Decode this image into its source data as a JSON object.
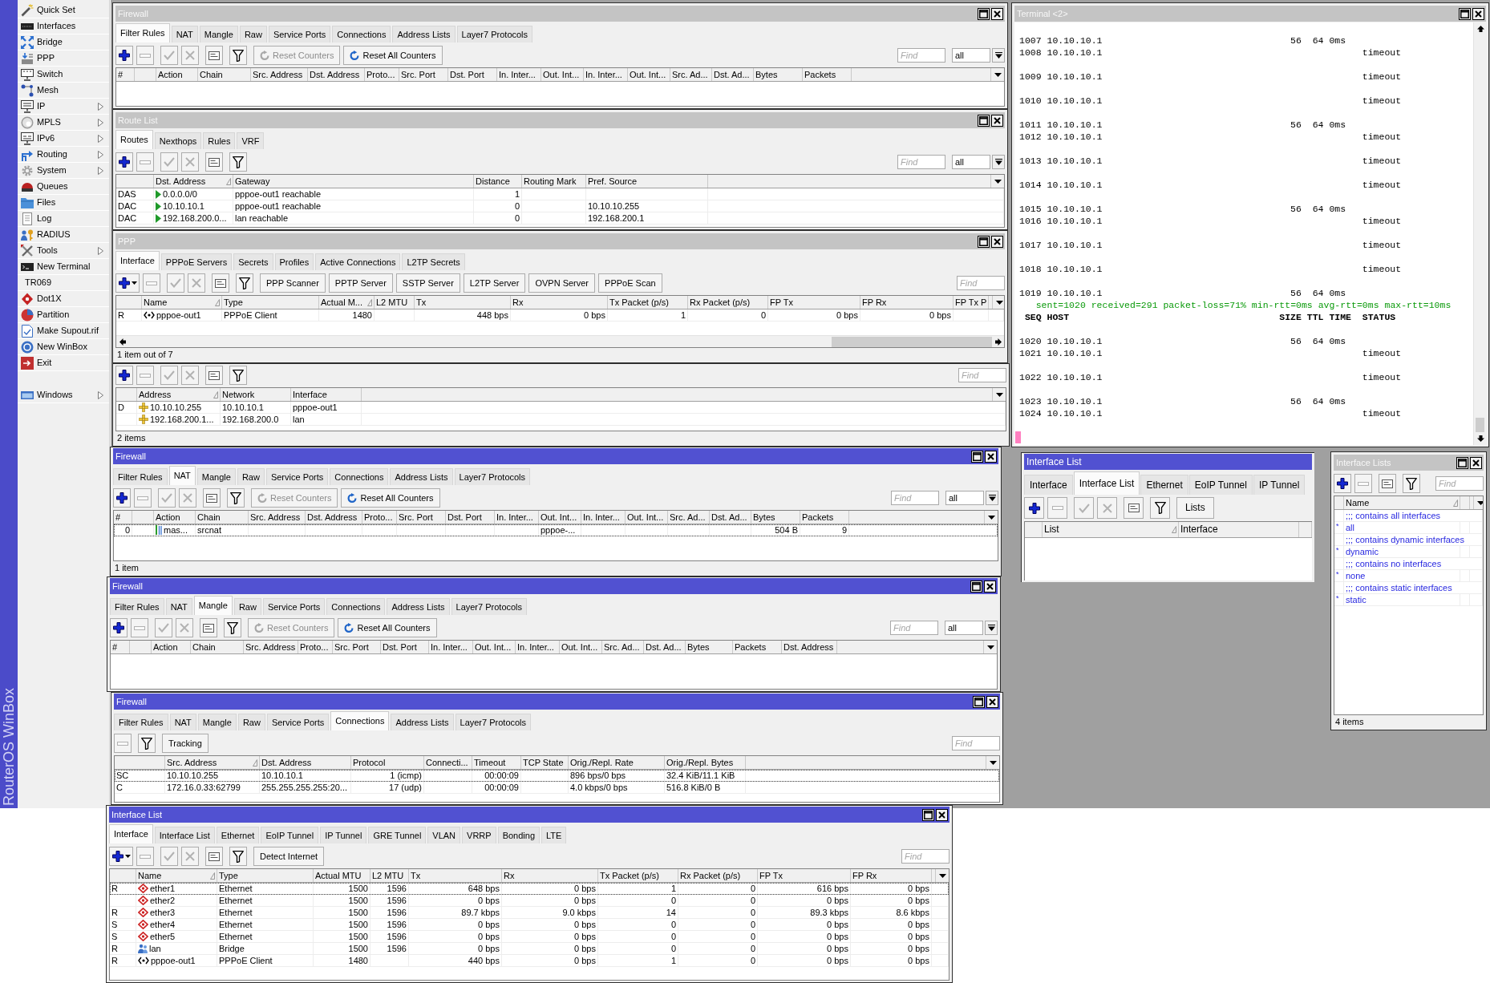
{
  "sidebar": {
    "brand": "RouterOS WinBox",
    "items": [
      {
        "label": "Quick Set",
        "submenu": false
      },
      {
        "label": "Interfaces",
        "submenu": false
      },
      {
        "label": "Bridge",
        "submenu": false
      },
      {
        "label": "PPP",
        "submenu": false
      },
      {
        "label": "Switch",
        "submenu": false
      },
      {
        "label": "Mesh",
        "submenu": false
      },
      {
        "label": "IP",
        "submenu": true
      },
      {
        "label": "MPLS",
        "submenu": true
      },
      {
        "label": "IPv6",
        "submenu": true
      },
      {
        "label": "Routing",
        "submenu": true
      },
      {
        "label": "System",
        "submenu": true
      },
      {
        "label": "Queues",
        "submenu": false
      },
      {
        "label": "Files",
        "submenu": false
      },
      {
        "label": "Log",
        "submenu": false
      },
      {
        "label": "RADIUS",
        "submenu": false
      },
      {
        "label": "Tools",
        "submenu": true
      },
      {
        "label": "New Terminal",
        "submenu": false
      },
      {
        "label": "TR069",
        "submenu": false
      },
      {
        "label": "Dot1X",
        "submenu": false
      },
      {
        "label": "Partition",
        "submenu": false
      },
      {
        "label": "Make Supout.rif",
        "submenu": false
      },
      {
        "label": "New WinBox",
        "submenu": false
      },
      {
        "label": "Exit",
        "submenu": false
      },
      {
        "label": "Windows",
        "submenu": true
      }
    ]
  },
  "windows": [
    {
      "kind": "table",
      "title": "Firewall",
      "active": false,
      "title_buttons": true,
      "tabs": [
        {
          "label": "Filter Rules",
          "selected": true
        },
        {
          "label": "NAT",
          "selected": false
        },
        {
          "label": "Mangle",
          "selected": false
        },
        {
          "label": "Raw",
          "selected": false
        },
        {
          "label": "Service Ports",
          "selected": false
        },
        {
          "label": "Connections",
          "selected": false
        },
        {
          "label": "Address Lists",
          "selected": false
        },
        {
          "label": "Layer7 Protocols",
          "selected": false
        }
      ],
      "toolbar": [
        {
          "kind": "add",
          "disabled": false
        },
        {
          "kind": "remove",
          "disabled": true
        },
        {
          "kind": "enable",
          "disabled": true
        },
        {
          "kind": "disable",
          "disabled": true
        },
        {
          "kind": "comment",
          "disabled": false
        },
        {
          "kind": "filter",
          "disabled": false
        },
        {
          "kind": "reset",
          "label": "Reset Counters",
          "disabled": true
        },
        {
          "kind": "reset",
          "label": "Reset All Counters",
          "disabled": false
        }
      ],
      "find": {
        "placeholder": "Find"
      },
      "select": {
        "value": "all"
      },
      "columns": [
        {
          "label": "#",
          "sorted": false
        },
        {
          "sorted": false
        },
        {
          "label": "Action",
          "sorted": false
        },
        {
          "label": "Chain",
          "sorted": false
        },
        {
          "label": "Src. Address",
          "sorted": false
        },
        {
          "label": "Dst. Address",
          "sorted": false
        },
        {
          "label": "Proto...",
          "sorted": false
        },
        {
          "label": "Src. Port",
          "sorted": false
        },
        {
          "label": "Dst. Port",
          "sorted": false
        },
        {
          "label": "In. Inter...",
          "sorted": false
        },
        {
          "label": "Out. Int...",
          "sorted": false
        },
        {
          "label": "In. Inter...",
          "sorted": false
        },
        {
          "label": "Out. Int...",
          "sorted": false
        },
        {
          "label": "Src. Ad...",
          "sorted": false
        },
        {
          "label": "Dst. Ad...",
          "sorted": false
        },
        {
          "label": "Bytes",
          "sorted": false
        },
        {
          "label": "Packets",
          "sorted": false
        }
      ]
    },
    {
      "kind": "table",
      "title": "Route List",
      "active": false,
      "title_buttons": true,
      "tabs": [
        {
          "label": "Routes",
          "selected": true
        },
        {
          "label": "Nexthops",
          "selected": false
        },
        {
          "label": "Rules",
          "selected": false
        },
        {
          "label": "VRF",
          "selected": false
        }
      ],
      "toolbar": [
        {
          "kind": "add",
          "disabled": false
        },
        {
          "kind": "remove",
          "disabled": true
        },
        {
          "kind": "enable",
          "disabled": true
        },
        {
          "kind": "disable",
          "disabled": true
        },
        {
          "kind": "comment",
          "disabled": false
        },
        {
          "kind": "filter",
          "disabled": false
        }
      ],
      "find": {
        "placeholder": "Find"
      },
      "select": {
        "value": "all"
      },
      "columns": [
        {
          "sorted": false
        },
        {
          "label": "Dst. Address",
          "sorted": true
        },
        {
          "label": "Gateway",
          "sorted": false
        },
        {
          "label": "Distance",
          "sorted": false
        },
        {
          "label": "Routing Mark",
          "sorted": false
        },
        {
          "label": "Pref. Source",
          "sorted": false
        }
      ],
      "rows": [
        {
          "cells": [
            "DAS",
            "0.0.0.0/0",
            "pppoe-out1 reachable",
            "1",
            null,
            null
          ]
        },
        {
          "cells": [
            "DAC",
            "10.10.10.1",
            "pppoe-out1 reachable",
            "0",
            null,
            "10.10.10.255"
          ]
        },
        {
          "cells": [
            "DAC",
            "192.168.200.0...",
            "lan reachable",
            "0",
            null,
            "192.168.200.1"
          ]
        }
      ]
    },
    {
      "kind": "table",
      "title": "PPP",
      "active": false,
      "title_buttons": true,
      "tabs": [
        {
          "label": "Interface",
          "selected": true
        },
        {
          "label": "PPPoE Servers",
          "selected": false
        },
        {
          "label": "Secrets",
          "selected": false
        },
        {
          "label": "Profiles",
          "selected": false
        },
        {
          "label": "Active Connections",
          "selected": false
        },
        {
          "label": "L2TP Secrets",
          "selected": false
        }
      ],
      "toolbar": [
        {
          "kind": "add_menu",
          "disabled": false
        },
        {
          "kind": "remove",
          "disabled": true
        },
        {
          "kind": "enable",
          "disabled": true
        },
        {
          "kind": "disable",
          "disabled": true
        },
        {
          "kind": "comment",
          "disabled": false
        },
        {
          "kind": "filter",
          "disabled": false
        },
        {
          "kind": "text",
          "label": "PPP Scanner",
          "disabled": false
        },
        {
          "kind": "text",
          "label": "PPTP Server",
          "disabled": false
        },
        {
          "kind": "text",
          "label": "SSTP Server",
          "disabled": false
        },
        {
          "kind": "text",
          "label": "L2TP Server",
          "disabled": false
        },
        {
          "kind": "text",
          "label": "OVPN Server",
          "disabled": false
        },
        {
          "kind": "text",
          "label": "PPPoE Scan",
          "disabled": false
        }
      ],
      "find": {
        "placeholder": "Find"
      },
      "columns": [
        {
          "sorted": false
        },
        {
          "label": "Name",
          "sorted": true
        },
        {
          "label": "Type",
          "sorted": false
        },
        {
          "label": "Actual M...",
          "sorted": true
        },
        {
          "label": "L2 MTU",
          "sorted": false
        },
        {
          "label": "Tx",
          "sorted": false
        },
        {
          "label": "Rx",
          "sorted": false
        },
        {
          "label": "Tx Packet (p/s)",
          "sorted": false
        },
        {
          "label": "Rx Packet (p/s)",
          "sorted": false
        },
        {
          "label": "FP Tx",
          "sorted": false
        },
        {
          "label": "FP Rx",
          "sorted": false
        },
        {
          "label": "FP Tx P",
          "sorted": false
        }
      ],
      "rows": [
        {
          "kind": "pppoe",
          "cells": [
            "R",
            "pppoe-out1",
            "PPPoE Client",
            "1480",
            null,
            "448 bps",
            "0 bps",
            "1",
            "0",
            "0 bps",
            "0 bps",
            null
          ]
        }
      ],
      "status": "1 item out of 7"
    },
    {
      "kind": "table",
      "toolbar": [
        {
          "kind": "add",
          "disabled": false
        },
        {
          "kind": "remove",
          "disabled": true
        },
        {
          "kind": "enable",
          "disabled": true
        },
        {
          "kind": "disable",
          "disabled": true
        },
        {
          "kind": "comment",
          "disabled": false
        },
        {
          "kind": "filter",
          "disabled": false
        }
      ],
      "find": {
        "placeholder": "Find"
      },
      "columns": [
        {
          "sorted": false
        },
        {
          "label": "Address",
          "sorted": true
        },
        {
          "label": "Network",
          "sorted": false
        },
        {
          "label": "Interface",
          "sorted": false
        }
      ],
      "rows": [
        {
          "cells": [
            "D",
            "10.10.10.255",
            "10.10.10.1",
            "pppoe-out1"
          ]
        },
        {
          "cells": [
            null,
            "192.168.200.1...",
            "192.168.200.0",
            "lan"
          ]
        }
      ],
      "status": "2 items"
    },
    {
      "kind": "table",
      "title": "Firewall",
      "active": true,
      "title_buttons": true,
      "tabs": [
        {
          "label": "Filter Rules",
          "selected": false
        },
        {
          "label": "NAT",
          "selected": true
        },
        {
          "label": "Mangle",
          "selected": false
        },
        {
          "label": "Raw",
          "selected": false
        },
        {
          "label": "Service Ports",
          "selected": false
        },
        {
          "label": "Connections",
          "selected": false
        },
        {
          "label": "Address Lists",
          "selected": false
        },
        {
          "label": "Layer7 Protocols",
          "selected": false
        }
      ],
      "toolbar": [
        {
          "kind": "add",
          "disabled": false
        },
        {
          "kind": "remove",
          "disabled": true
        },
        {
          "kind": "enable",
          "disabled": true
        },
        {
          "kind": "disable",
          "disabled": true
        },
        {
          "kind": "comment",
          "disabled": false
        },
        {
          "kind": "filter",
          "disabled": false
        },
        {
          "kind": "reset",
          "label": "Reset Counters",
          "disabled": true
        },
        {
          "kind": "reset",
          "label": "Reset All Counters",
          "disabled": false
        }
      ],
      "find": {
        "placeholder": "Find"
      },
      "select": {
        "value": "all"
      },
      "columns": [
        {
          "label": "#",
          "sorted": false
        },
        {
          "sorted": false
        },
        {
          "label": "Action",
          "sorted": false
        },
        {
          "label": "Chain",
          "sorted": false
        },
        {
          "label": "Src. Address",
          "sorted": false
        },
        {
          "label": "Dst. Address",
          "sorted": false
        },
        {
          "label": "Proto...",
          "sorted": false
        },
        {
          "label": "Src. Port",
          "sorted": false
        },
        {
          "label": "Dst. Port",
          "sorted": false
        },
        {
          "label": "In. Inter...",
          "sorted": false
        },
        {
          "label": "Out. Int...",
          "sorted": false
        },
        {
          "label": "In. Inter...",
          "sorted": false
        },
        {
          "label": "Out. Int...",
          "sorted": false
        },
        {
          "label": "Src. Ad...",
          "sorted": false
        },
        {
          "label": "Dst. Ad...",
          "sorted": false
        },
        {
          "label": "Bytes",
          "sorted": false
        },
        {
          "label": "Packets",
          "sorted": false
        }
      ],
      "rows": [
        {
          "focused": true,
          "cells": [
            "0",
            null,
            "mas...",
            "srcnat",
            null,
            null,
            null,
            null,
            null,
            null,
            "pppoe-...",
            null,
            null,
            null,
            null,
            "504 B",
            "9"
          ]
        }
      ],
      "status": "1 item"
    },
    {
      "kind": "table",
      "title": "Firewall",
      "active": true,
      "title_buttons": true,
      "tabs": [
        {
          "label": "Filter Rules",
          "selected": false
        },
        {
          "label": "NAT",
          "selected": false
        },
        {
          "label": "Mangle",
          "selected": true
        },
        {
          "label": "Raw",
          "selected": false
        },
        {
          "label": "Service Ports",
          "selected": false
        },
        {
          "label": "Connections",
          "selected": false
        },
        {
          "label": "Address Lists",
          "selected": false
        },
        {
          "label": "Layer7 Protocols",
          "selected": false
        }
      ],
      "toolbar": [
        {
          "kind": "add",
          "disabled": false
        },
        {
          "kind": "remove",
          "disabled": true
        },
        {
          "kind": "enable",
          "disabled": true
        },
        {
          "kind": "disable",
          "disabled": true
        },
        {
          "kind": "comment",
          "disabled": false
        },
        {
          "kind": "filter",
          "disabled": false
        },
        {
          "kind": "reset",
          "label": "Reset Counters",
          "disabled": true
        },
        {
          "kind": "reset",
          "label": "Reset All Counters",
          "disabled": false
        }
      ],
      "find": {
        "placeholder": "Find"
      },
      "select": {
        "value": "all"
      },
      "columns": [
        {
          "label": "#",
          "sorted": false
        },
        {
          "sorted": false
        },
        {
          "label": "Action",
          "sorted": false
        },
        {
          "label": "Chain",
          "sorted": false
        },
        {
          "label": "Src. Address",
          "sorted": false
        },
        {
          "label": "Proto...",
          "sorted": false
        },
        {
          "label": "Src. Port",
          "sorted": false
        },
        {
          "label": "Dst. Port",
          "sorted": false
        },
        {
          "label": "In. Inter...",
          "sorted": false
        },
        {
          "label": "Out. Int...",
          "sorted": false
        },
        {
          "label": "In. Inter...",
          "sorted": false
        },
        {
          "label": "Out. Int...",
          "sorted": false
        },
        {
          "label": "Src. Ad...",
          "sorted": false
        },
        {
          "label": "Dst. Ad...",
          "sorted": false
        },
        {
          "label": "Bytes",
          "sorted": false
        },
        {
          "label": "Packets",
          "sorted": false
        },
        {
          "label": "Dst. Address",
          "sorted": false
        }
      ]
    },
    {
      "kind": "table",
      "title": "Firewall",
      "active": true,
      "title_buttons": true,
      "tabs": [
        {
          "label": "Filter Rules",
          "selected": false
        },
        {
          "label": "NAT",
          "selected": false
        },
        {
          "label": "Mangle",
          "selected": false
        },
        {
          "label": "Raw",
          "selected": false
        },
        {
          "label": "Service Ports",
          "selected": false
        },
        {
          "label": "Connections",
          "selected": true
        },
        {
          "label": "Address Lists",
          "selected": false
        },
        {
          "label": "Layer7 Protocols",
          "selected": false
        }
      ],
      "toolbar": [
        {
          "kind": "remove",
          "disabled": true
        },
        {
          "kind": "filter",
          "disabled": false
        },
        {
          "kind": "text",
          "label": "Tracking",
          "disabled": false
        }
      ],
      "find": {
        "placeholder": "Find"
      },
      "columns": [
        {
          "sorted": false
        },
        {
          "label": "Src. Address",
          "sorted": true
        },
        {
          "label": "Dst. Address",
          "sorted": false
        },
        {
          "label": "Protocol",
          "sorted": false
        },
        {
          "label": "Connecti...",
          "sorted": false
        },
        {
          "label": "Timeout",
          "sorted": false
        },
        {
          "label": "TCP State",
          "sorted": false
        },
        {
          "label": "Orig./Repl. Rate",
          "sorted": false
        },
        {
          "label": "Orig./Repl. Bytes",
          "sorted": false
        }
      ],
      "rows": [
        {
          "focused": true,
          "cells": [
            "SC",
            "10.10.10.255",
            "10.10.10.1",
            "1 (icmp)",
            null,
            "00:00:09",
            null,
            "896 bps/0 bps",
            "32.4 KiB/11.1 KiB"
          ]
        },
        {
          "focused": false,
          "cells": [
            "C",
            "172.16.0.33:62799",
            "255.255.255.255:20...",
            "17 (udp)",
            null,
            "00:00:09",
            null,
            "4.0 kbps/0 bps",
            "516.8 KiB/0 B"
          ]
        }
      ]
    },
    {
      "kind": "terminal",
      "title": "Terminal <2>",
      "active": false,
      "title_buttons": true,
      "lines": [
        {
          "kind": "blank"
        },
        {
          "kind": "row",
          "seq": "1007",
          "host": "10.10.10.1",
          "size": "56",
          "ttl": "64",
          "time": "0ms"
        },
        {
          "kind": "row",
          "seq": "1008",
          "host": "10.10.10.1",
          "status": "timeout"
        },
        {
          "kind": "blank"
        },
        {
          "kind": "row",
          "seq": "1009",
          "host": "10.10.10.1",
          "status": "timeout"
        },
        {
          "kind": "blank"
        },
        {
          "kind": "row",
          "seq": "1010",
          "host": "10.10.10.1",
          "status": "timeout"
        },
        {
          "kind": "blank"
        },
        {
          "kind": "row",
          "seq": "1011",
          "host": "10.10.10.1",
          "size": "56",
          "ttl": "64",
          "time": "0ms"
        },
        {
          "kind": "row",
          "seq": "1012",
          "host": "10.10.10.1",
          "status": "timeout"
        },
        {
          "kind": "blank"
        },
        {
          "kind": "row",
          "seq": "1013",
          "host": "10.10.10.1",
          "status": "timeout"
        },
        {
          "kind": "blank"
        },
        {
          "kind": "row",
          "seq": "1014",
          "host": "10.10.10.1",
          "status": "timeout"
        },
        {
          "kind": "blank"
        },
        {
          "kind": "row",
          "seq": "1015",
          "host": "10.10.10.1",
          "size": "56",
          "ttl": "64",
          "time": "0ms"
        },
        {
          "kind": "row",
          "seq": "1016",
          "host": "10.10.10.1",
          "status": "timeout"
        },
        {
          "kind": "blank"
        },
        {
          "kind": "row",
          "seq": "1017",
          "host": "10.10.10.1",
          "status": "timeout"
        },
        {
          "kind": "blank"
        },
        {
          "kind": "row",
          "seq": "1018",
          "host": "10.10.10.1",
          "status": "timeout"
        },
        {
          "kind": "blank"
        },
        {
          "kind": "row",
          "seq": "1019",
          "host": "10.10.10.1",
          "size": "56",
          "ttl": "64",
          "time": "0ms"
        },
        {
          "kind": "summary",
          "text": "sent=1020 received=291 packet-loss=71% min-rtt=0ms avg-rtt=0ms max-rtt=10ms"
        },
        {
          "kind": "header",
          "seq": "SEQ",
          "host": "HOST",
          "size": "SIZE",
          "ttl": "TTL",
          "time": "TIME",
          "status": "STATUS"
        },
        {
          "kind": "blank"
        },
        {
          "kind": "row",
          "seq": "1020",
          "host": "10.10.10.1",
          "size": "56",
          "ttl": "64",
          "time": "0ms"
        },
        {
          "kind": "row",
          "seq": "1021",
          "host": "10.10.10.1",
          "status": "timeout"
        },
        {
          "kind": "blank"
        },
        {
          "kind": "row",
          "seq": "1022",
          "host": "10.10.10.1",
          "status": "timeout"
        },
        {
          "kind": "blank"
        },
        {
          "kind": "row",
          "seq": "1023",
          "host": "10.10.10.1",
          "size": "56",
          "ttl": "64",
          "time": "0ms"
        },
        {
          "kind": "row",
          "seq": "1024",
          "host": "10.10.10.1",
          "status": "timeout"
        },
        {
          "kind": "blank"
        }
      ],
      "cursor": true
    },
    {
      "kind": "table",
      "title": "Interface List",
      "active": true,
      "title_buttons": false,
      "tabs": [
        {
          "label": "Interface",
          "selected": false
        },
        {
          "label": "Interface List",
          "selected": true
        },
        {
          "label": "Ethernet",
          "selected": false
        },
        {
          "label": "EoIP Tunnel",
          "selected": false
        },
        {
          "label": "IP Tunnel",
          "selected": false
        }
      ],
      "toolbar": [
        {
          "kind": "add",
          "disabled": false
        },
        {
          "kind": "remove",
          "disabled": true
        },
        {
          "kind": "enable",
          "disabled": true
        },
        {
          "kind": "disable",
          "disabled": true
        },
        {
          "kind": "comment",
          "disabled": false
        },
        {
          "kind": "filter",
          "disabled": false
        },
        {
          "kind": "text",
          "label": "Lists",
          "disabled": false
        }
      ],
      "columns": [
        {
          "sorted": false
        },
        {
          "label": "List",
          "sorted": true
        },
        {
          "label": "Interface",
          "sorted": false
        }
      ]
    },
    {
      "kind": "table",
      "title": "Interface Lists",
      "active": false,
      "title_buttons": true,
      "toolbar": [
        {
          "kind": "add",
          "disabled": false
        },
        {
          "kind": "remove",
          "disabled": true
        },
        {
          "kind": "comment",
          "disabled": false
        },
        {
          "kind": "filter",
          "disabled": false
        }
      ],
      "find": {
        "placeholder": "Find"
      },
      "columns": [
        {
          "sorted": false
        },
        {
          "label": "Name",
          "sorted": true
        },
        {
          "sorted": false
        }
      ],
      "rows": [
        {
          "kind": "comment",
          "cells": [
            ";;; contains all interfaces"
          ]
        },
        {
          "kind": "item",
          "cells": [
            "*",
            "all"
          ]
        },
        {
          "kind": "comment",
          "cells": [
            ";;; contains dynamic interfaces"
          ]
        },
        {
          "kind": "item",
          "cells": [
            "*",
            "dynamic"
          ]
        },
        {
          "kind": "comment",
          "cells": [
            ";;; contains no interfaces"
          ]
        },
        {
          "kind": "item",
          "cells": [
            "*",
            "none"
          ]
        },
        {
          "kind": "comment",
          "cells": [
            ";;; contains static interfaces"
          ]
        },
        {
          "kind": "item",
          "cells": [
            "*",
            "static"
          ]
        }
      ],
      "status": "4 items"
    },
    {
      "kind": "table",
      "title": "Interface List",
      "active": true,
      "title_buttons": true,
      "tabs": [
        {
          "label": "Interface",
          "selected": true
        },
        {
          "label": "Interface List",
          "selected": false
        },
        {
          "label": "Ethernet",
          "selected": false
        },
        {
          "label": "EoIP Tunnel",
          "selected": false
        },
        {
          "label": "IP Tunnel",
          "selected": false
        },
        {
          "label": "GRE Tunnel",
          "selected": false
        },
        {
          "label": "VLAN",
          "selected": false
        },
        {
          "label": "VRRP",
          "selected": false
        },
        {
          "label": "Bonding",
          "selected": false
        },
        {
          "label": "LTE",
          "selected": false
        }
      ],
      "toolbar": [
        {
          "kind": "add_menu",
          "disabled": false
        },
        {
          "kind": "remove",
          "disabled": true
        },
        {
          "kind": "enable",
          "disabled": true
        },
        {
          "kind": "disable",
          "disabled": true
        },
        {
          "kind": "comment",
          "disabled": false
        },
        {
          "kind": "filter",
          "disabled": false
        },
        {
          "kind": "text",
          "label": "Detect Internet",
          "disabled": false
        }
      ],
      "find": {
        "placeholder": "Find"
      },
      "columns": [
        {
          "sorted": false
        },
        {
          "label": "Name",
          "sorted": true
        },
        {
          "label": "Type",
          "sorted": false
        },
        {
          "label": "Actual MTU",
          "sorted": false
        },
        {
          "label": "L2 MTU",
          "sorted": false
        },
        {
          "label": "Tx",
          "sorted": false
        },
        {
          "label": "Rx",
          "sorted": false
        },
        {
          "label": "Tx Packet (p/s)",
          "sorted": false
        },
        {
          "label": "Rx Packet (p/s)",
          "sorted": false
        },
        {
          "label": "FP Tx",
          "sorted": false
        },
        {
          "label": "FP Rx",
          "sorted": false
        }
      ],
      "rows": [
        {
          "kind": "ethernet",
          "focused": true,
          "cells": [
            "R",
            "ether1",
            "Ethernet",
            "1500",
            "1596",
            "648 bps",
            "0 bps",
            "1",
            "0",
            "616 bps",
            "0 bps"
          ]
        },
        {
          "kind": "ethernet",
          "focused": false,
          "cells": [
            null,
            "ether2",
            "Ethernet",
            "1500",
            "1596",
            "0 bps",
            "0 bps",
            "0",
            "0",
            "0 bps",
            "0 bps"
          ]
        },
        {
          "kind": "ethernet",
          "focused": false,
          "cells": [
            "R",
            "ether3",
            "Ethernet",
            "1500",
            "1596",
            "89.7 kbps",
            "9.0 kbps",
            "14",
            "0",
            "89.3 kbps",
            "8.6 kbps"
          ]
        },
        {
          "kind": "ethernet",
          "focused": false,
          "cells": [
            "S",
            "ether4",
            "Ethernet",
            "1500",
            "1596",
            "0 bps",
            "0 bps",
            "0",
            "0",
            "0 bps",
            "0 bps"
          ]
        },
        {
          "kind": "ethernet",
          "focused": false,
          "cells": [
            "S",
            "ether5",
            "Ethernet",
            "1500",
            "1596",
            "0 bps",
            "0 bps",
            "0",
            "0",
            "0 bps",
            "0 bps"
          ]
        },
        {
          "kind": "bridge",
          "focused": false,
          "cells": [
            "R",
            "lan",
            "Bridge",
            "1500",
            "1596",
            "0 bps",
            "0 bps",
            "0",
            "0",
            "0 bps",
            "0 bps"
          ]
        },
        {
          "kind": "pppoe",
          "focused": false,
          "cells": [
            "R",
            "pppoe-out1",
            "PPPoE Client",
            "1480",
            null,
            "440 bps",
            "0 bps",
            "1",
            "0",
            "0 bps",
            "0 bps"
          ]
        }
      ]
    }
  ]
}
